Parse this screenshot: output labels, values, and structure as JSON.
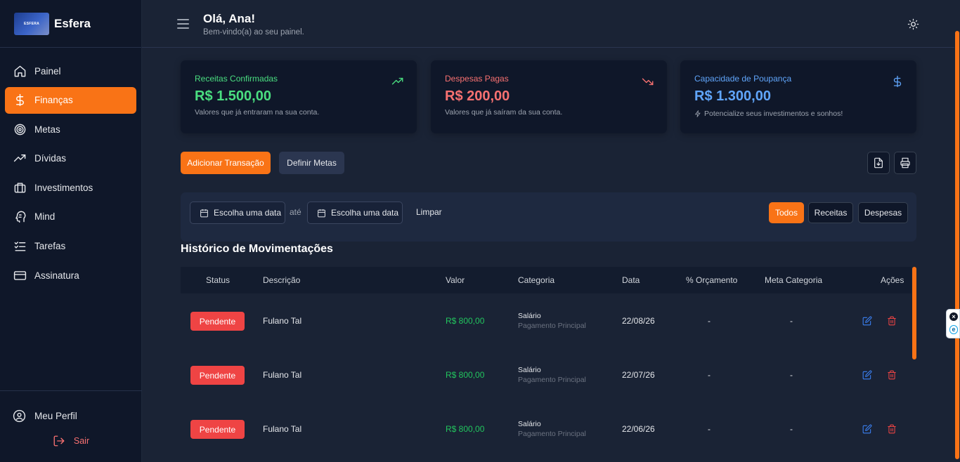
{
  "brand": {
    "name": "Esfera",
    "logo_text": "ESFERA"
  },
  "sidebar": {
    "items": [
      {
        "label": "Painel",
        "icon": "home-icon"
      },
      {
        "label": "Finanças",
        "icon": "dollar-icon",
        "active": true
      },
      {
        "label": "Metas",
        "icon": "target-icon"
      },
      {
        "label": "Dívidas",
        "icon": "trending-up-icon"
      },
      {
        "label": "Investimentos",
        "icon": "briefcase-icon"
      },
      {
        "label": "Mind",
        "icon": "brain-icon"
      },
      {
        "label": "Tarefas",
        "icon": "list-checks-icon"
      },
      {
        "label": "Assinatura",
        "icon": "credit-card-icon"
      }
    ],
    "profile_label": "Meu Perfil",
    "logout_label": "Sair"
  },
  "header": {
    "greeting": "Olá, Ana!",
    "subtitle": "Bem-vindo(a) ao seu painel."
  },
  "cards": [
    {
      "title": "Receitas Confirmadas",
      "value": "R$ 1.500,00",
      "subtitle": "Valores que já entraram na sua conta.",
      "icon": "trending-up-icon",
      "color": "#4ade80"
    },
    {
      "title": "Despesas Pagas",
      "value": "R$ 200,00",
      "subtitle": "Valores que já saíram da sua conta.",
      "icon": "trending-down-icon",
      "color": "#f87171"
    },
    {
      "title": "Capacidade de Poupança",
      "value": "R$ 1.300,00",
      "subtitle": "Potencialize seus investimentos e sonhos!",
      "icon": "dollar-icon",
      "color": "#60a5fa"
    }
  ],
  "actions": {
    "add_transaction": "Adicionar Transação",
    "define_goals": "Definir Metas"
  },
  "filters": {
    "date_from": "Escolha uma data",
    "between": "até",
    "date_to": "Escolha uma data",
    "clear": "Limpar",
    "types": [
      "Todos",
      "Receitas",
      "Despesas"
    ],
    "active_type": "Todos"
  },
  "history": {
    "title": "Histórico de Movimentações",
    "columns": [
      "Status",
      "Descrição",
      "Valor",
      "Categoria",
      "Data",
      "% Orçamento",
      "Meta Categoria",
      "Ações"
    ],
    "rows": [
      {
        "status": "Pendente",
        "description": "Fulano Tal",
        "value": "R$ 800,00",
        "category": "Salário",
        "subcategory": "Pagamento Principal",
        "date": "22/08/26",
        "budget": "-",
        "goal": "-"
      },
      {
        "status": "Pendente",
        "description": "Fulano Tal",
        "value": "R$ 800,00",
        "category": "Salário",
        "subcategory": "Pagamento Principal",
        "date": "22/07/26",
        "budget": "-",
        "goal": "-"
      },
      {
        "status": "Pendente",
        "description": "Fulano Tal",
        "value": "R$ 800,00",
        "category": "Salário",
        "subcategory": "Pagamento Principal",
        "date": "22/06/26",
        "budget": "-",
        "goal": "-"
      }
    ]
  },
  "colors": {
    "accent": "#f97316",
    "danger": "#ef4444",
    "positive": "#22c55e",
    "info": "#60a5fa"
  }
}
